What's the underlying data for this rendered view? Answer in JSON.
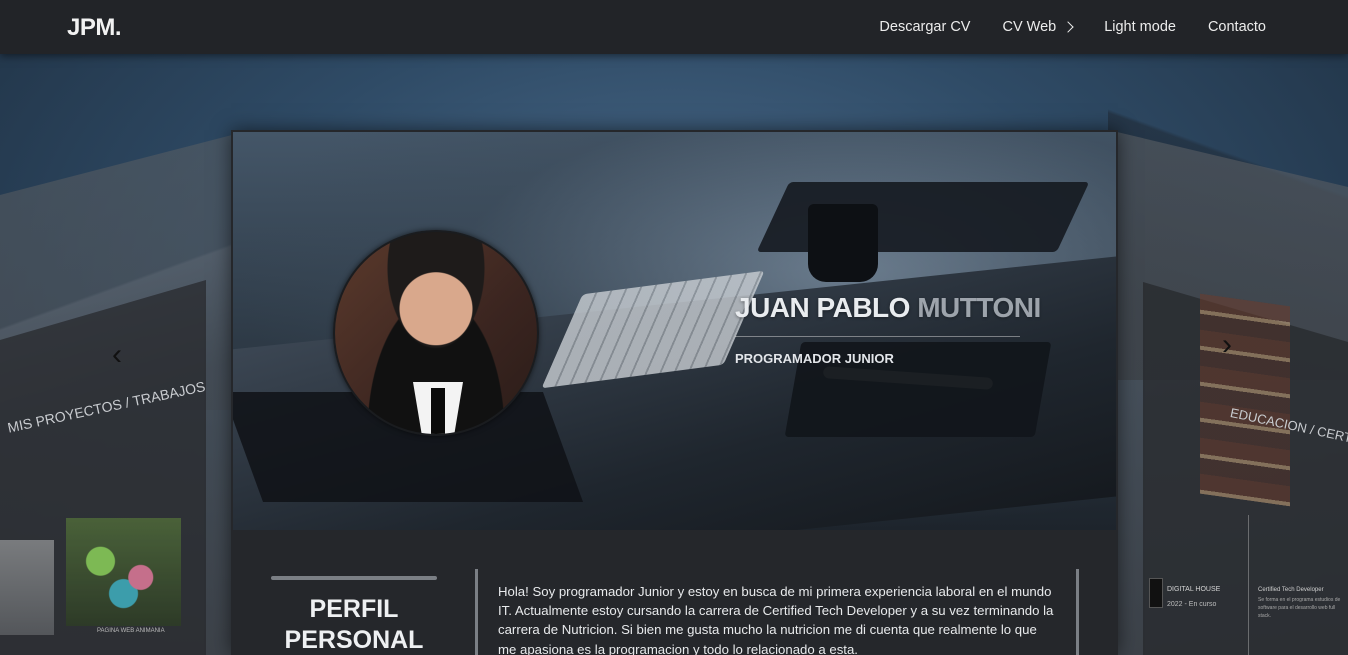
{
  "navbar": {
    "logo": "JPM.",
    "links": [
      {
        "label": "Descargar CV"
      },
      {
        "label": "CV Web"
      },
      {
        "label": "Light mode"
      },
      {
        "label": "Contacto"
      }
    ]
  },
  "carousel": {
    "left_panel": {
      "title": "MIS PROYECTOS / TRABAJOS",
      "thumb_caption": "PAGINA WEB ANIMANIA",
      "prev_arrow": "‹"
    },
    "right_panel": {
      "title": "EDUCACION / CERTIFICADOS",
      "next_arrow": "›",
      "edu_name": "DIGITAL HOUSE",
      "edu_years": "2022 - En curso",
      "cert_title": "Certified Tech Developer",
      "cert_desc": "Se forma en el programa estudios de software para el desarrollo web full stack."
    }
  },
  "hero": {
    "first_name": "JUAN PABLO ",
    "last_name": "MUTTONI",
    "role": "PROGRAMADOR JUNIOR"
  },
  "profile": {
    "title": "PERFIL PERSONAL",
    "text": "Hola! Soy programador Junior y estoy en busca de mi primera experiencia laboral en el mundo IT. Actualmente estoy cursando la carrera de Certified Tech Developer y a su vez terminando la carrera de Nutricion. Si bien me gusta mucho la nutricion me di cuenta que realmente lo que me apasiona es la programacion y todo lo relacionado a esta."
  },
  "colors": {
    "navbar_bg": "#222428",
    "card_bg": "#25272b",
    "accent_bar": "#7b7f85"
  }
}
